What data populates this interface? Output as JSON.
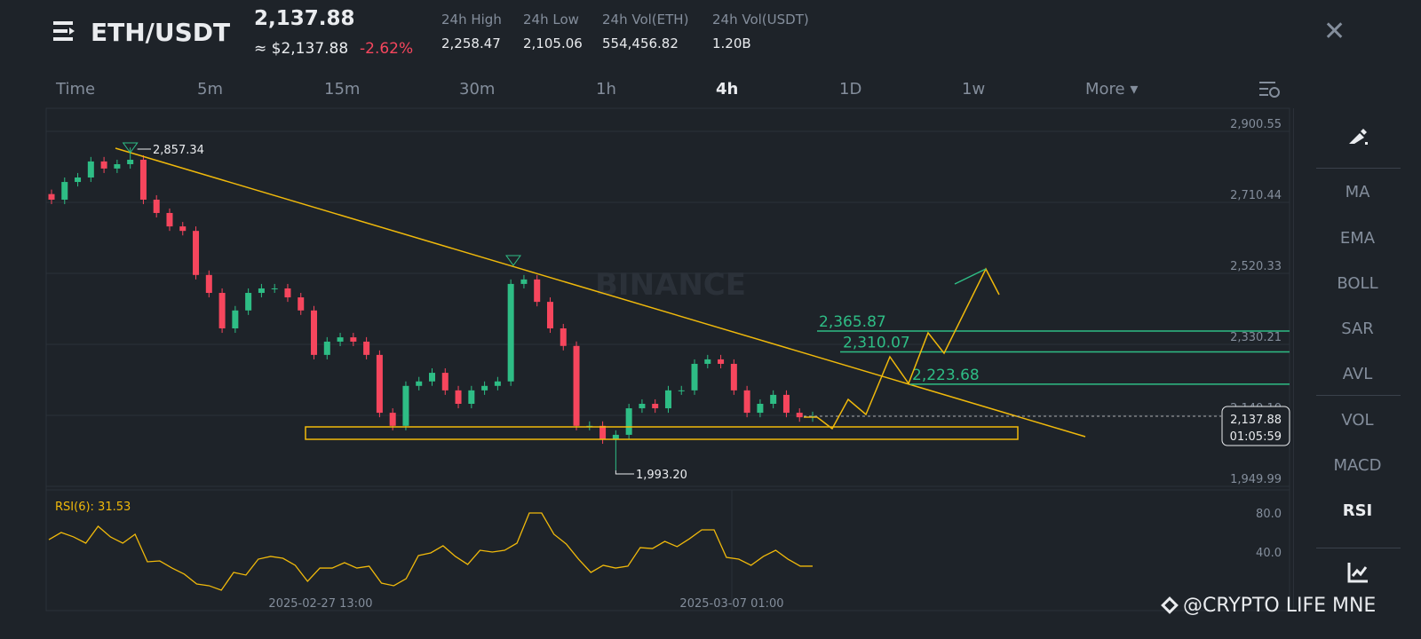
{
  "header": {
    "pair": "ETH/USDT",
    "last_price": "2,137.88",
    "approx_price": "≈ $2,137.88",
    "change": "-2.62%",
    "stats": [
      {
        "label": "24h High",
        "value": "2,258.47"
      },
      {
        "label": "24h Low",
        "value": "2,105.06"
      },
      {
        "label": "24h Vol(ETH)",
        "value": "554,456.82"
      },
      {
        "label": "24h Vol(USDT)",
        "value": "1.20B"
      }
    ],
    "close_icon": "✕"
  },
  "timeframes": [
    "Time",
    "5m",
    "15m",
    "30m",
    "1h",
    "4h",
    "1D",
    "1w"
  ],
  "active_timeframe": "4h",
  "more_label": "More ▾",
  "sidebar": {
    "items": [
      "MA",
      "EMA",
      "BOLL",
      "SAR",
      "AVL",
      "VOL",
      "MACD",
      "RSI"
    ],
    "active": "RSI"
  },
  "watermark": "@CRYPTO LIFE MNE",
  "colors": {
    "up": "#2ebd85",
    "down": "#f6465d",
    "drawing": "#f0b90b",
    "level": "#2ebd85"
  },
  "chart_data": {
    "type": "candlestick",
    "watermark": "BINANCE",
    "price_ticks": [
      "2,900.55",
      "2,710.44",
      "2,520.33",
      "2,330.21",
      "2,140.10",
      "1,949.99"
    ],
    "price_tick_values": [
      2900.55,
      2710.44,
      2520.33,
      2330.21,
      2140.1,
      1949.99
    ],
    "ylim": [
      1949.99,
      2900.55
    ],
    "time_labels": [
      "2025-02-27 13:00",
      "2025-03-07 01:00"
    ],
    "closes": [
      2717.6,
      2765,
      2777,
      2820,
      2801,
      2812.6,
      2824.5,
      2717.6,
      2682,
      2646,
      2634,
      2516,
      2468,
      2373,
      2421,
      2468,
      2480,
      2480,
      2456,
      2421,
      2302,
      2337.5,
      2349,
      2337.5,
      2302,
      2147,
      2112,
      2219,
      2231,
      2254,
      2207,
      2171,
      2207,
      2219,
      2231,
      2492,
      2504,
      2444,
      2373,
      2326,
      2112,
      2112,
      2076,
      2088,
      2159,
      2171,
      2159,
      2207,
      2207,
      2278,
      2290,
      2278,
      2207,
      2147,
      2171,
      2195,
      2147,
      2135,
      2137.88
    ],
    "high_marker": {
      "label": "2,857.34",
      "value": 2857.34,
      "index": 6
    },
    "low_marker": {
      "label": "1,993.20",
      "value": 1993.2,
      "index": 43
    },
    "current": {
      "price": "2,137.88",
      "countdown": "01:05:59",
      "value": 2137.88
    },
    "levels": [
      {
        "label": "2,365.87",
        "value": 2365.87
      },
      {
        "label": "2,310.07",
        "value": 2310.07
      },
      {
        "label": "2,223.68",
        "value": 2223.68
      }
    ],
    "rsi": {
      "label": "RSI(6): 31.53",
      "ticks": [
        "80.0",
        "40.0"
      ],
      "values": [
        52.7,
        60,
        55.5,
        49.1,
        66.4,
        55.5,
        49.1,
        58.2,
        30,
        30.9,
        23.6,
        17.3,
        7.3,
        5.5,
        0.9,
        19.1,
        16.4,
        32.7,
        35.5,
        33.6,
        26.4,
        10,
        23.6,
        23.6,
        29.1,
        23.6,
        25.5,
        8.2,
        5.5,
        12.7,
        36.4,
        39.1,
        46.4,
        35.5,
        27.3,
        41.8,
        40,
        41.8,
        49.1,
        80,
        80,
        58.2,
        48.2,
        32.7,
        19.1,
        26.4,
        23.6,
        25.5,
        44.5,
        43.6,
        50.9,
        45.5,
        53.6,
        62.7,
        62.7,
        34.5,
        32.7,
        26.4,
        35.5,
        41.8,
        32.7,
        25.5,
        25.5
      ]
    }
  }
}
